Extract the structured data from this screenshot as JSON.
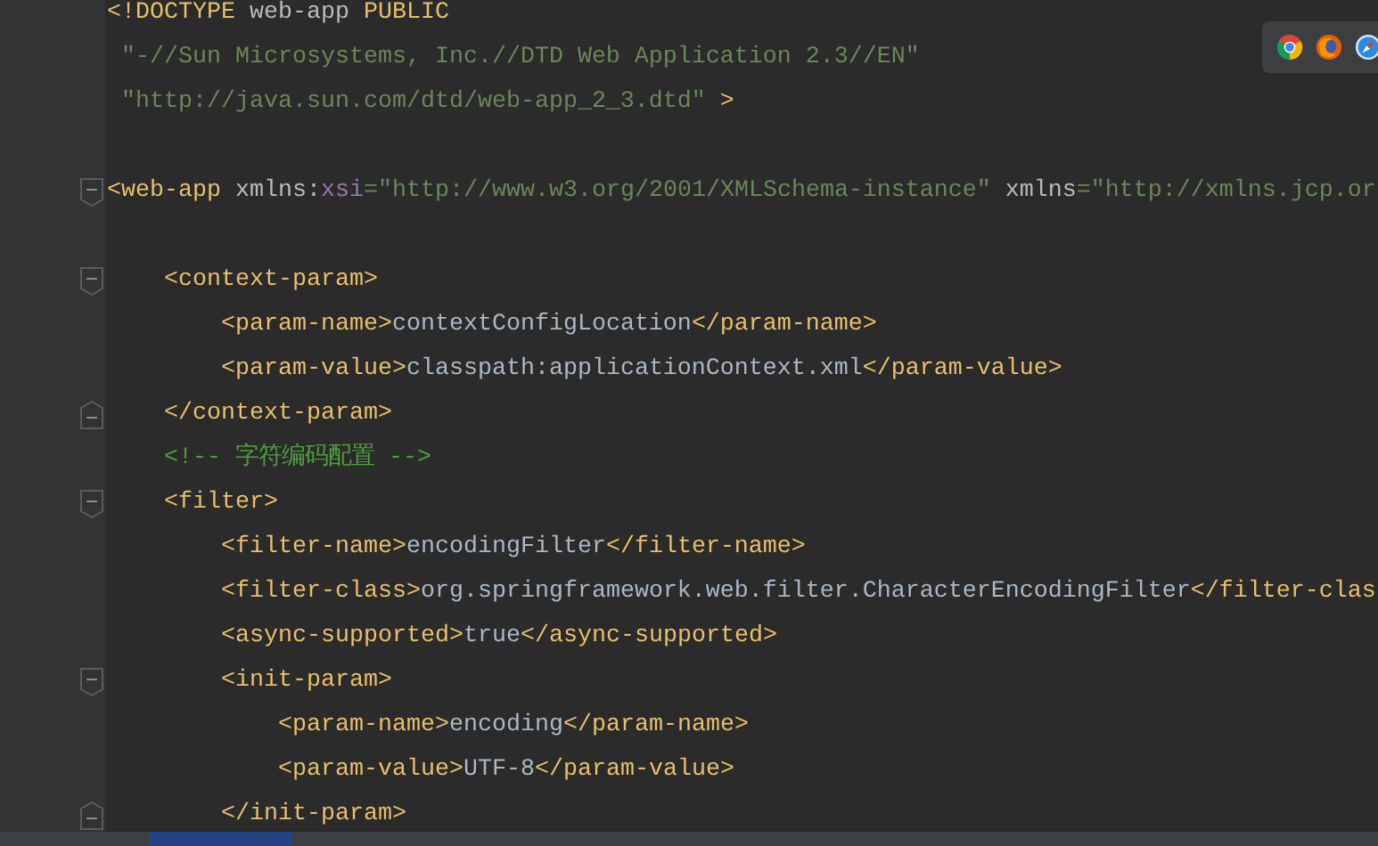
{
  "editor": {
    "lines": [
      {
        "kind": "plain",
        "tokens": [
          {
            "kind": "tag",
            "text": "<!DOCTYPE"
          },
          {
            "kind": "plain",
            "text": " web-app "
          },
          {
            "kind": "tag",
            "text": "PUBLIC"
          }
        ]
      },
      {
        "kind": "plain",
        "tokens": [
          {
            "kind": "string",
            "text": " \"-//Sun Microsystems, Inc.//DTD Web Application 2.3//EN\""
          }
        ]
      },
      {
        "kind": "plain",
        "tokens": [
          {
            "kind": "string",
            "text": " \"http://java.sun.com/dtd/web-app_2_3.dtd\""
          },
          {
            "kind": "tag",
            "text": " >"
          }
        ]
      },
      {
        "kind": "plain"
      },
      {
        "kind": "opening",
        "tokens": [
          {
            "kind": "tag",
            "text": "<web-app"
          },
          {
            "kind": "plain",
            "text": " xmlns:"
          },
          {
            "kind": "ns",
            "text": "xsi"
          },
          {
            "kind": "string",
            "text": "=\"http://www.w3.org/2001/XMLSchema-instance\""
          },
          {
            "kind": "plain",
            "text": " xmlns"
          },
          {
            "kind": "string",
            "text": "=\"http://xmlns.jcp.or"
          }
        ]
      },
      {
        "kind": "plain"
      },
      {
        "kind": "opening",
        "tokens": [
          {
            "kind": "tag",
            "text": "    <context-param>"
          }
        ]
      },
      {
        "kind": "plain",
        "tokens": [
          {
            "kind": "tag",
            "text": "        <param-name>"
          },
          {
            "kind": "text",
            "text": "contextConfigLocation"
          },
          {
            "kind": "tag",
            "text": "</param-name>"
          }
        ]
      },
      {
        "kind": "plain",
        "tokens": [
          {
            "kind": "tag",
            "text": "        <param-value>"
          },
          {
            "kind": "text",
            "text": "classpath:applicationContext.xml"
          },
          {
            "kind": "tag",
            "text": "</param-value>"
          }
        ]
      },
      {
        "kind": "closing",
        "tokens": [
          {
            "kind": "tag",
            "text": "    </context-param>"
          }
        ]
      },
      {
        "kind": "plain",
        "tokens": [
          {
            "kind": "comment",
            "text": "    <!-- 字符编码配置 -->"
          }
        ]
      },
      {
        "kind": "opening",
        "tokens": [
          {
            "kind": "tag",
            "text": "    <filter>"
          }
        ]
      },
      {
        "kind": "plain",
        "tokens": [
          {
            "kind": "tag",
            "text": "        <filter-name>"
          },
          {
            "kind": "text",
            "text": "encodingFilter"
          },
          {
            "kind": "tag",
            "text": "</filter-name>"
          }
        ]
      },
      {
        "kind": "plain",
        "tokens": [
          {
            "kind": "tag",
            "text": "        <filter-class>"
          },
          {
            "kind": "text",
            "text": "org.springframework.web.filter.CharacterEncodingFilter"
          },
          {
            "kind": "tag",
            "text": "</filter-clas"
          }
        ]
      },
      {
        "kind": "plain",
        "tokens": [
          {
            "kind": "tag",
            "text": "        <async-supported>"
          },
          {
            "kind": "text",
            "text": "true"
          },
          {
            "kind": "tag",
            "text": "</async-supported>"
          }
        ]
      },
      {
        "kind": "opening",
        "tokens": [
          {
            "kind": "tag",
            "text": "        <init-param>"
          }
        ]
      },
      {
        "kind": "plain",
        "tokens": [
          {
            "kind": "tag",
            "text": "            <param-name>"
          },
          {
            "kind": "text",
            "text": "encoding"
          },
          {
            "kind": "tag",
            "text": "</param-name>"
          }
        ]
      },
      {
        "kind": "plain",
        "tokens": [
          {
            "kind": "tag",
            "text": "            <param-value>"
          },
          {
            "kind": "text",
            "text": "UTF-8"
          },
          {
            "kind": "tag",
            "text": "</param-value>"
          }
        ]
      },
      {
        "kind": "closing",
        "tokens": [
          {
            "kind": "tag",
            "text": "        </init-param>"
          }
        ]
      }
    ]
  }
}
